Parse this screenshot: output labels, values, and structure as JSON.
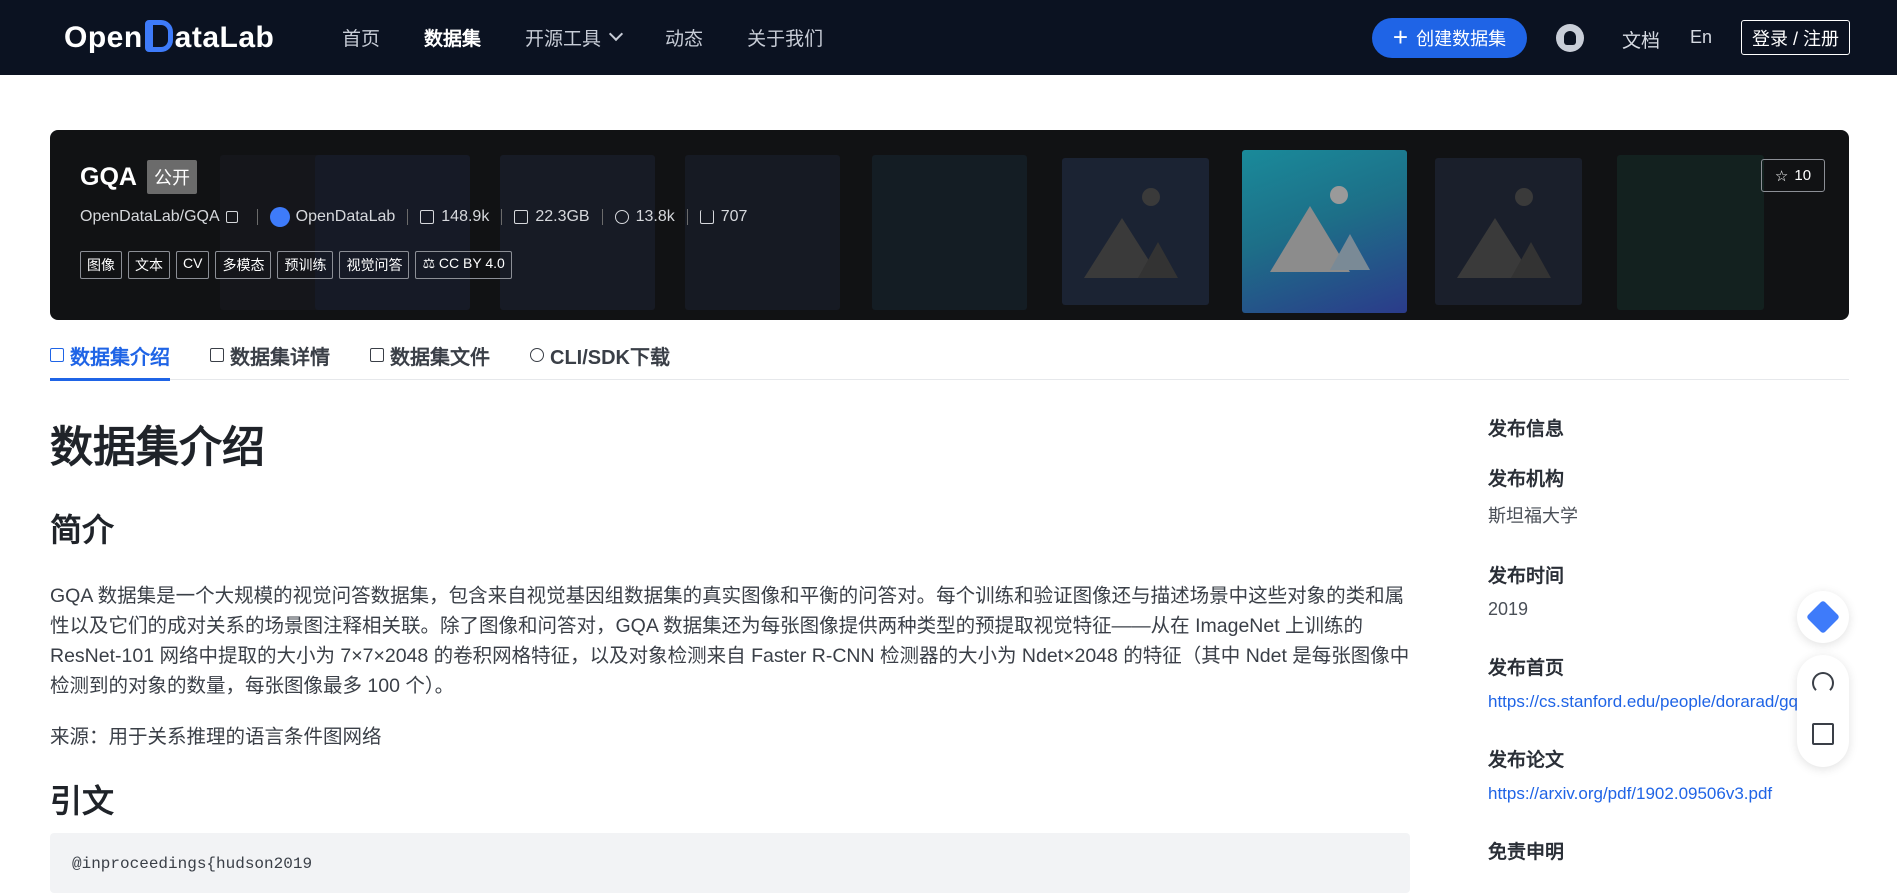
{
  "nav": {
    "logo_text_1": "Open",
    "logo_text_2": "ataLab",
    "items": [
      {
        "label": "首页"
      },
      {
        "label": "数据集"
      },
      {
        "label": "开源工具"
      },
      {
        "label": "动态"
      },
      {
        "label": "关于我们"
      }
    ],
    "create_label": "创建数据集",
    "docs_label": "文档",
    "lang_label": "En",
    "login_label": "登录 / 注册"
  },
  "banner": {
    "title": "GQA",
    "badge": "公开",
    "repo": "OpenDataLab/GQA",
    "org": "OpenDataLab",
    "stats": {
      "size_count": "148.9k",
      "disk": "22.3GB",
      "views": "13.8k",
      "downloads": "707"
    },
    "tags": [
      "图像",
      "文本",
      "CV",
      "多模态",
      "预训练",
      "视觉问答",
      "CC BY 4.0"
    ],
    "stars": "10"
  },
  "tabs": [
    {
      "label": "数据集介绍"
    },
    {
      "label": "数据集详情"
    },
    {
      "label": "数据集文件"
    },
    {
      "label": "CLI/SDK下载"
    }
  ],
  "main": {
    "heading": "数据集介绍",
    "intro_heading": "简介",
    "intro_text": "GQA 数据集是一个大规模的视觉问答数据集，包含来自视觉基因组数据集的真实图像和平衡的问答对。每个训练和验证图像还与描述场景中这些对象的类和属性以及它们的成对关系的场景图注释相关联。除了图像和问答对，GQA 数据集还为每张图像提供两种类型的预提取视觉特征——从在 ImageNet 上训练的 ResNet-101 网络中提取的大小为 7×7×2048 的卷积网格特征，以及对象检测来自 Faster R-CNN 检测器的大小为 Ndet×2048 的特征（其中 Ndet 是每张图像中检测到的对象的数量，每张图像最多 100 个）。",
    "source_text": "来源：用于关系推理的语言条件图网络",
    "citation_heading": "引文",
    "code_snippet": "@inproceedings{hudson2019"
  },
  "side": {
    "section_title": "发布信息",
    "org_label": "发布机构",
    "org_value": "斯坦福大学",
    "time_label": "发布时间",
    "time_value": "2019",
    "home_label": "发布首页",
    "home_value": "https://cs.stanford.edu/people/dorarad/gqa/",
    "paper_label": "发布论文",
    "paper_value": "https://arxiv.org/pdf/1902.09506v3.pdf",
    "disclaimer_label": "免责申明"
  }
}
